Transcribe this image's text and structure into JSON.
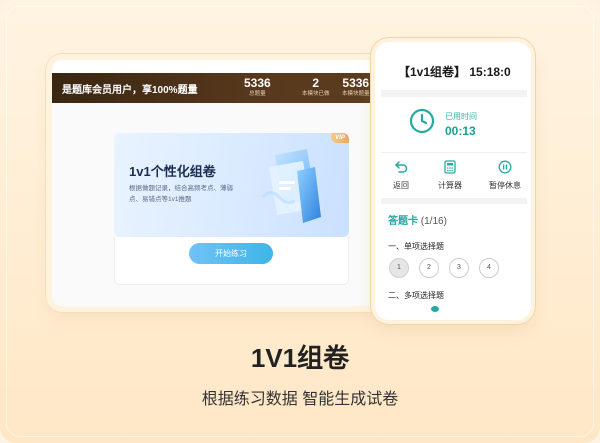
{
  "tablet": {
    "header_text": "是题库会员用户，享100%题量",
    "stats": [
      {
        "value": "5336",
        "label": "总题量"
      },
      {
        "value": "2",
        "label": "本模块已做"
      },
      {
        "value": "5336",
        "label": "本模块题量"
      }
    ],
    "vip_badge": "VIP",
    "banner_title": "1v1个性化组卷",
    "banner_desc": "根据做题记录，结合高频考点、薄弱点、易错点等1v1推题",
    "start_button": "开始练习"
  },
  "phone": {
    "title": "【1v1组卷】 15:18:0",
    "timer_label": "已用时间",
    "timer_value": "00:13",
    "tools": [
      {
        "label": "返回",
        "icon": "back-arrow-icon"
      },
      {
        "label": "计算器",
        "icon": "calculator-icon"
      },
      {
        "label": "暂停休息",
        "icon": "pause-icon"
      }
    ],
    "answer_card_title": "答题卡",
    "answer_card_count": "(1/16)",
    "sections": [
      "一、单项选择题",
      "二、多项选择题"
    ],
    "questions": [
      "1",
      "2",
      "3",
      "4"
    ]
  },
  "caption": {
    "title": "1V1组卷",
    "subtitle": "根据练习数据 智能生成试卷"
  },
  "colors": {
    "accent_teal": "#25a9a2",
    "header_brown": "#3a2612",
    "button_blue": "#3fb5e7"
  }
}
